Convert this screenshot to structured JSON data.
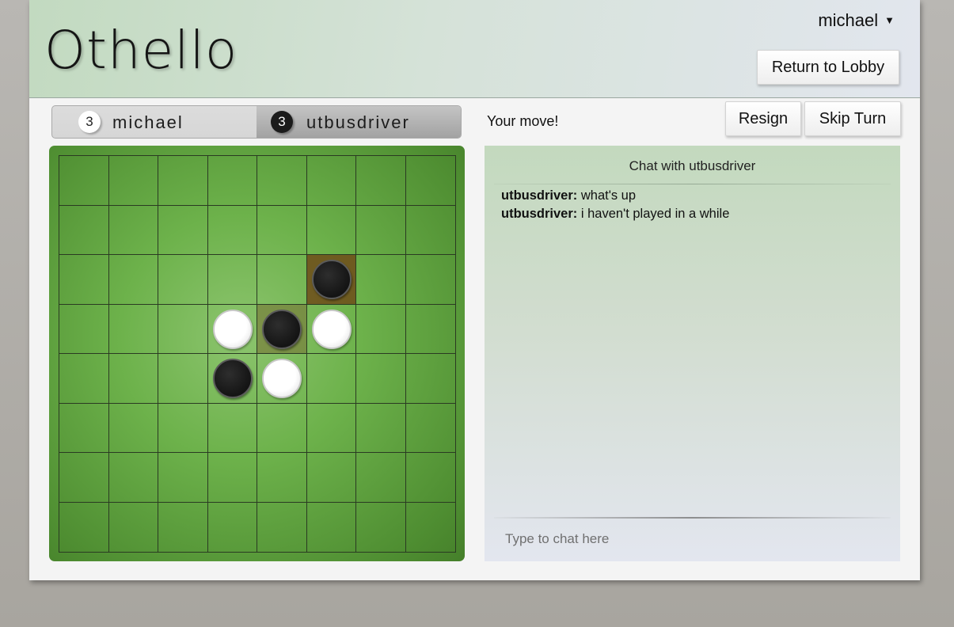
{
  "header": {
    "logo": "Othello",
    "username": "michael",
    "lobby_label": "Return to Lobby"
  },
  "scores": {
    "me": {
      "name": "michael",
      "count": "3",
      "color": "white"
    },
    "opponent": {
      "name": "utbusdriver",
      "count": "3",
      "color": "black"
    }
  },
  "status": "Your move!",
  "actions": {
    "resign_label": "Resign",
    "skip_label": "Skip Turn"
  },
  "board": {
    "size": 8,
    "pieces": [
      {
        "row": 2,
        "col": 5,
        "color": "black"
      },
      {
        "row": 3,
        "col": 3,
        "color": "white"
      },
      {
        "row": 3,
        "col": 4,
        "color": "black"
      },
      {
        "row": 3,
        "col": 5,
        "color": "white"
      },
      {
        "row": 4,
        "col": 3,
        "color": "black"
      },
      {
        "row": 4,
        "col": 4,
        "color": "white"
      }
    ],
    "highlights": [
      {
        "row": 2,
        "col": 5,
        "kind": "last-move"
      },
      {
        "row": 3,
        "col": 4,
        "kind": "flipped"
      }
    ],
    "colors": {
      "felt": "#6db24b",
      "last_move": "#6e4b19",
      "flipped": "#787d3c"
    }
  },
  "chat": {
    "title": "Chat with utbusdriver",
    "messages": [
      {
        "author": "utbusdriver:",
        "text": " what's up"
      },
      {
        "author": "utbusdriver:",
        "text": " i haven't played in a while"
      }
    ],
    "placeholder": "Type to chat here"
  }
}
